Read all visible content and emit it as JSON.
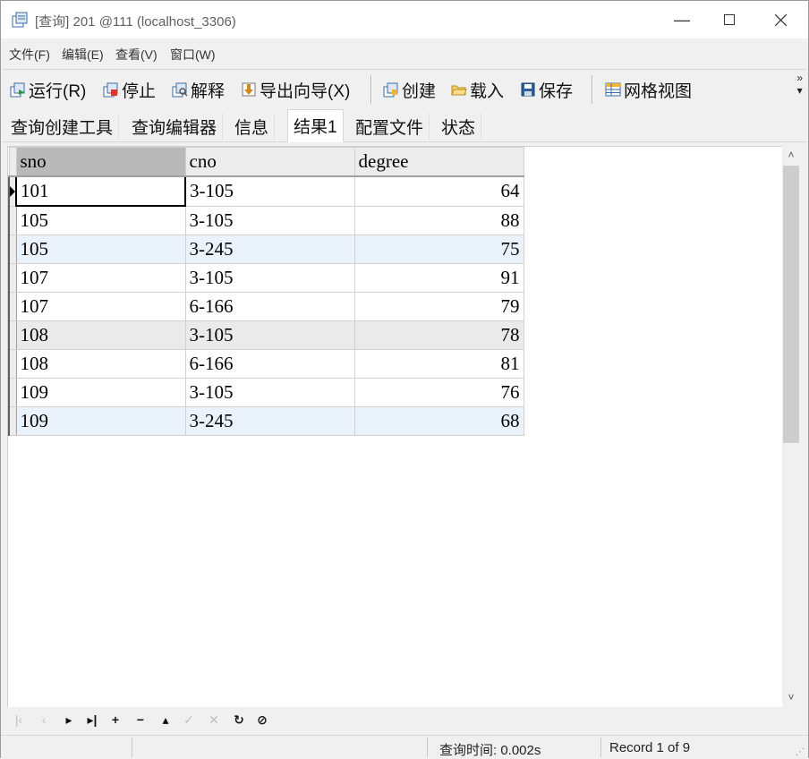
{
  "window": {
    "title": "[查询] 201 @111 (localhost_3306)"
  },
  "menu": [
    "文件(F)",
    "编辑(E)",
    "查看(V)",
    "窗口(W)"
  ],
  "toolbar": {
    "run": "运行(R)",
    "stop": "停止",
    "explain": "解释",
    "export": "导出向导(X)",
    "create": "创建",
    "load": "载入",
    "save": "保存",
    "gridview": "网格视图",
    "overflow": "»"
  },
  "tabs": [
    "查询创建工具",
    "查询编辑器",
    "信息",
    "结果1",
    "配置文件",
    "状态"
  ],
  "active_tab": "结果1",
  "grid": {
    "columns": [
      "sno",
      "cno",
      "degree"
    ],
    "rows": [
      [
        "101",
        "3-105",
        "64"
      ],
      [
        "105",
        "3-105",
        "88"
      ],
      [
        "105",
        "3-245",
        "75"
      ],
      [
        "107",
        "3-105",
        "91"
      ],
      [
        "107",
        "6-166",
        "79"
      ],
      [
        "108",
        "3-105",
        "78"
      ],
      [
        "108",
        "6-166",
        "81"
      ],
      [
        "109",
        "3-105",
        "76"
      ],
      [
        "109",
        "3-245",
        "68"
      ]
    ]
  },
  "status": {
    "query_time": "查询时间: 0.002s",
    "record": "Record 1 of 9"
  },
  "colors": {
    "row_highlight": "#eaf3fb",
    "row_gray": "#eaeaea",
    "header_selected": "#b9b9b9"
  }
}
